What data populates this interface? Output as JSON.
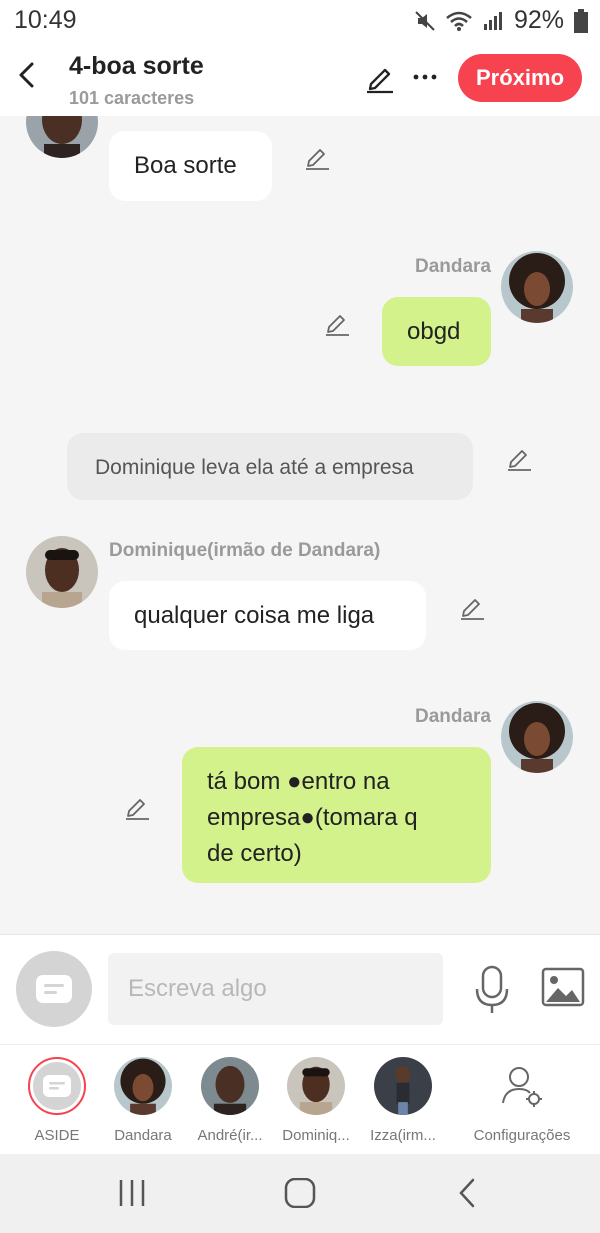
{
  "status": {
    "time": "10:49",
    "battery": "92%"
  },
  "header": {
    "title": "4-boa sorte",
    "subtitle": "101 caracteres",
    "next_label": "Próximo"
  },
  "messages": [
    {
      "type": "left",
      "sender": "",
      "text": "Boa sorte"
    },
    {
      "type": "right",
      "sender": "Dandara",
      "text": "obgd"
    },
    {
      "type": "narration",
      "text": "Dominique leva ela até a empresa"
    },
    {
      "type": "left",
      "sender": "Dominique(irmão de Dandara)",
      "text": "qualquer coisa me liga"
    },
    {
      "type": "right",
      "sender": "Dandara",
      "line1": "tá bom ●entro na",
      "line2": "empresa●(tomara q",
      "line3": "de certo)"
    }
  ],
  "input": {
    "placeholder": "Escreva algo"
  },
  "characters": [
    {
      "label": "ASIDE"
    },
    {
      "label": "Dandara"
    },
    {
      "label": "André(ir..."
    },
    {
      "label": "Dominiq..."
    },
    {
      "label": "Izza(irm..."
    },
    {
      "label": "Configurações"
    }
  ],
  "colors": {
    "accent": "#f6434f",
    "user_bubble": "#d3f28c",
    "other_bubble": "#ffffff",
    "narration_bubble": "#ebebeb"
  }
}
